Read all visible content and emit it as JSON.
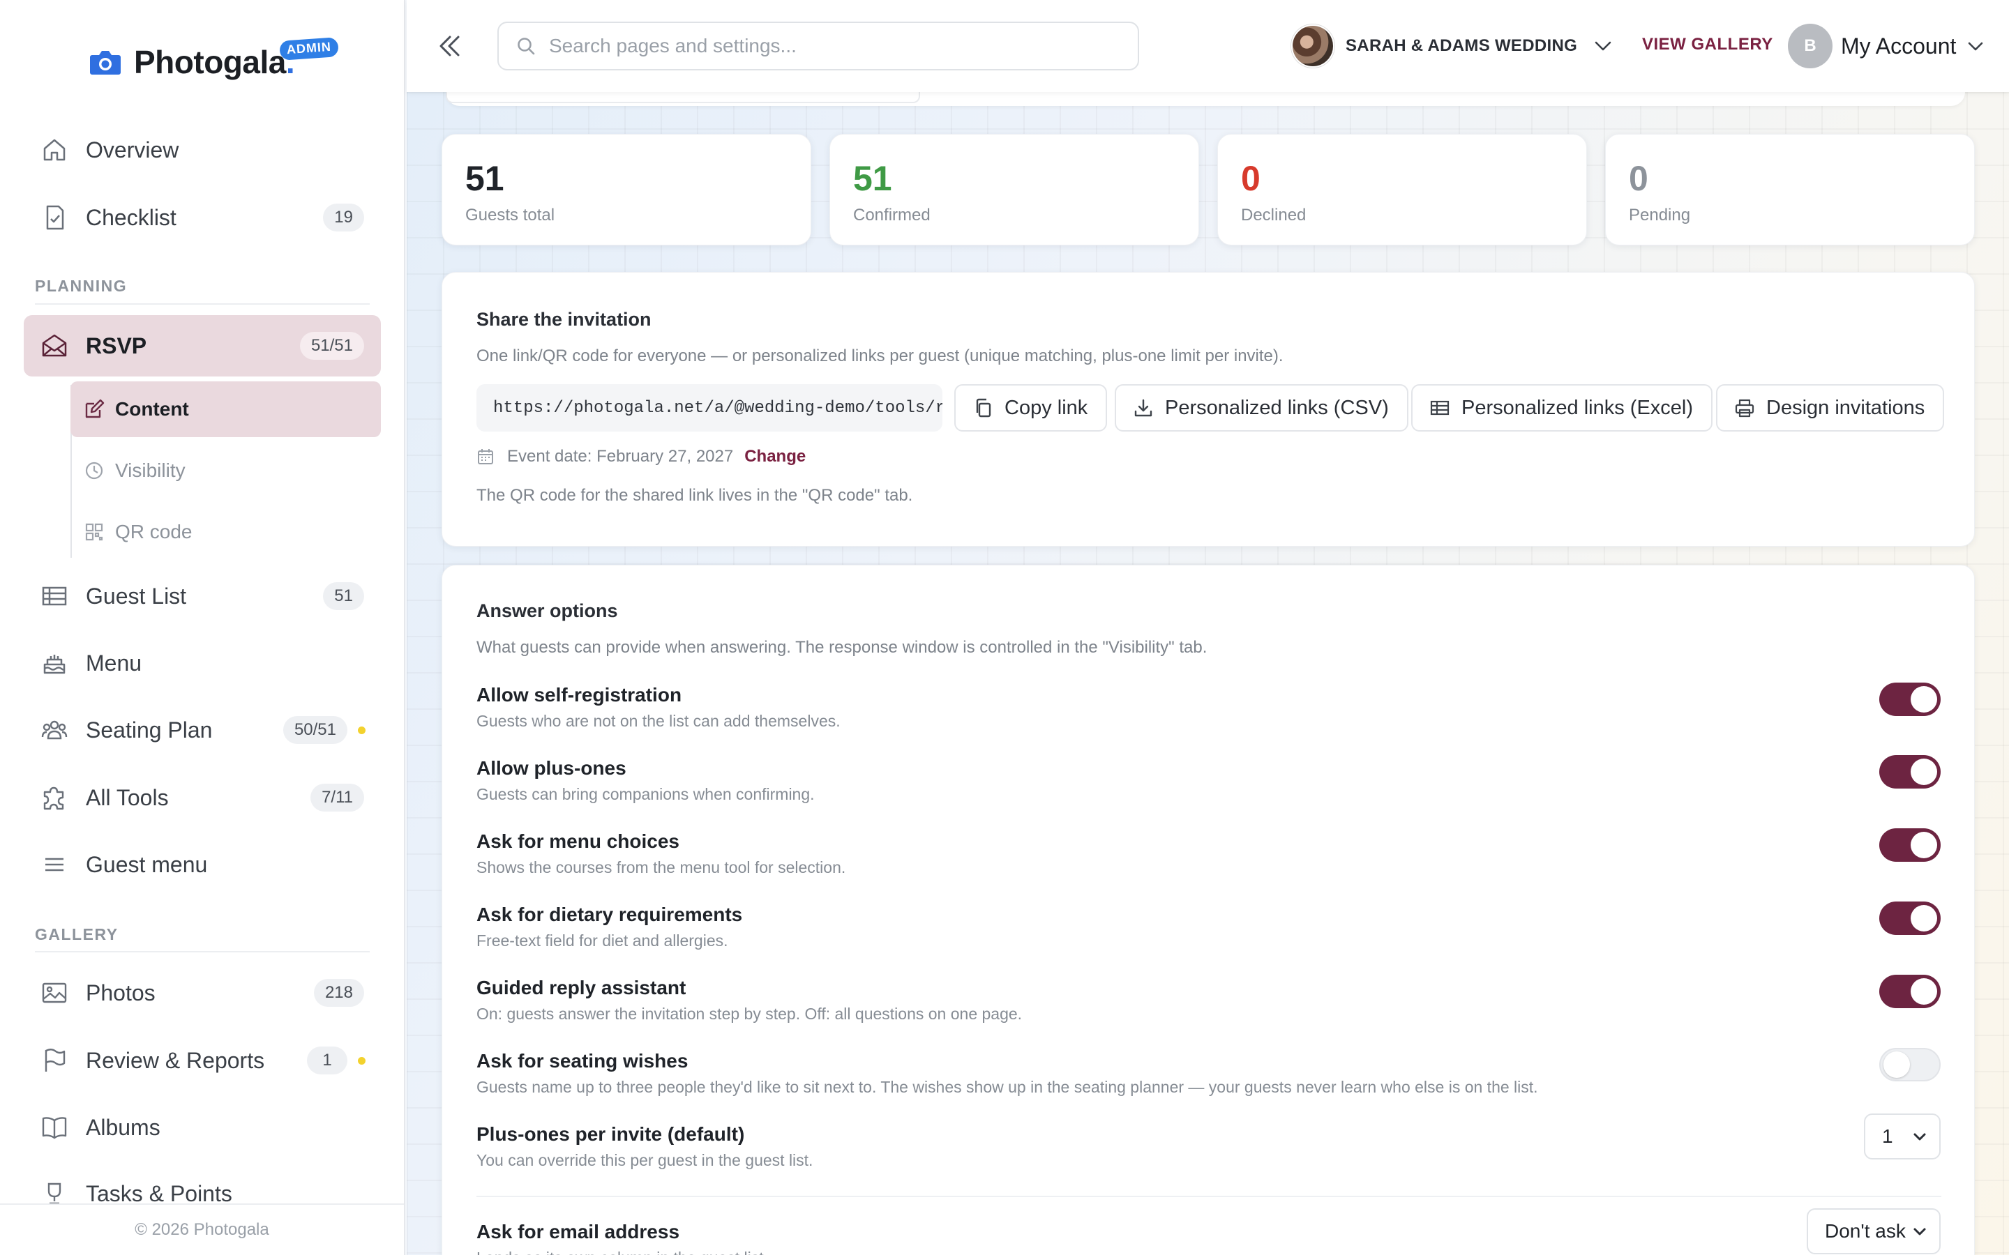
{
  "brand": {
    "name": "Photogala",
    "dot": ".",
    "badge": "ADMIN"
  },
  "sidebar": {
    "top_items": [
      {
        "label": "Overview",
        "icon": "home-icon"
      },
      {
        "label": "Checklist",
        "icon": "checklist-icon",
        "badge": "19"
      }
    ],
    "planning_heading": "PLANNING",
    "rsvp": {
      "label": "RSVP",
      "badge": "51/51"
    },
    "rsvp_sub": [
      {
        "label": "Content",
        "icon": "edit-icon"
      },
      {
        "label": "Visibility",
        "icon": "clock-icon"
      },
      {
        "label": "QR code",
        "icon": "qr-icon"
      }
    ],
    "planning_items": [
      {
        "label": "Guest List",
        "badge": "51"
      },
      {
        "label": "Menu"
      },
      {
        "label": "Seating Plan",
        "badge": "50/51"
      },
      {
        "label": "All Tools",
        "badge": "7/11"
      },
      {
        "label": "Guest menu"
      }
    ],
    "gallery_heading": "GALLERY",
    "gallery_items": [
      {
        "label": "Photos",
        "badge": "218"
      },
      {
        "label": "Review & Reports",
        "badge": "1"
      },
      {
        "label": "Albums"
      },
      {
        "label": "Tasks & Points"
      }
    ],
    "footer": "© 2026 Photogala"
  },
  "topbar": {
    "search_placeholder": "Search pages and settings...",
    "event_name": "SARAH & ADAMS WEDDING",
    "view_gallery": "VIEW GALLERY",
    "account_initial": "B",
    "account_label": "My Account"
  },
  "stats": [
    {
      "value": "51",
      "label": "Guests total",
      "color": "#1f2329"
    },
    {
      "value": "51",
      "label": "Confirmed",
      "color": "#3f9a45"
    },
    {
      "value": "0",
      "label": "Declined",
      "color": "#d73a2c"
    },
    {
      "value": "0",
      "label": "Pending",
      "color": "#8d939b"
    }
  ],
  "share": {
    "title": "Share the invitation",
    "subtitle": "One link/QR code for everyone — or personalized links per guest (unique matching, plus-one limit per invite).",
    "link": "https://photogala.net/a/@wedding-demo/tools/r…",
    "copy": "Copy link",
    "csv": "Personalized links (CSV)",
    "excel": "Personalized links (Excel)",
    "design": "Design invitations",
    "event_date": "Event date: February 27, 2027",
    "change": "Change",
    "qr_note": "The QR code for the shared link lives in the \"QR code\" tab."
  },
  "answers": {
    "title": "Answer options",
    "subtitle": "What guests can provide when answering. The response window is controlled in the \"Visibility\" tab.",
    "options": [
      {
        "title": "Allow self-registration",
        "desc": "Guests who are not on the list can add themselves.",
        "on": true
      },
      {
        "title": "Allow plus-ones",
        "desc": "Guests can bring companions when confirming.",
        "on": true
      },
      {
        "title": "Ask for menu choices",
        "desc": "Shows the courses from the menu tool for selection.",
        "on": true
      },
      {
        "title": "Ask for dietary requirements",
        "desc": "Free-text field for diet and allergies.",
        "on": true
      },
      {
        "title": "Guided reply assistant",
        "desc": "On: guests answer the invitation step by step. Off: all questions on one page.",
        "on": true
      },
      {
        "title": "Ask for seating wishes",
        "desc": "Guests name up to three people they'd like to sit next to. The wishes show up in the seating planner — your guests never learn who else is on the list.",
        "on": false
      }
    ],
    "plus_ones": {
      "title": "Plus-ones per invite (default)",
      "desc": "You can override this per guest in the guest list.",
      "value": "1"
    },
    "email": {
      "title": "Ask for email address",
      "desc": "Lands as its own column in the guest list.",
      "value": "Don't ask"
    }
  },
  "colors": {
    "accent": "#6d2441",
    "link": "#7a2141",
    "admin_badge": "#2f7fe6",
    "confirmed": "#3f9a45",
    "declined": "#d73a2c"
  }
}
